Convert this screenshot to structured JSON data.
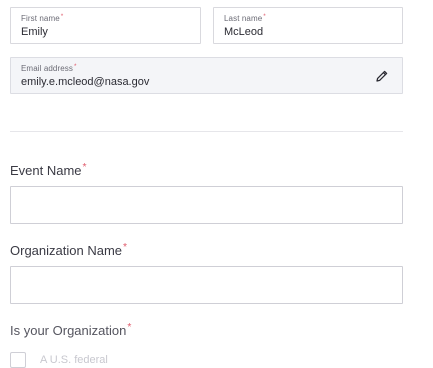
{
  "profile": {
    "first_name": {
      "label": "First name",
      "value": "Emily"
    },
    "last_name": {
      "label": "Last name",
      "value": "McLeod"
    },
    "email": {
      "label": "Email address",
      "value": "emily.e.mcleod@nasa.gov"
    }
  },
  "required_mark": "*",
  "form": {
    "event_name": {
      "label": "Event Name",
      "value": ""
    },
    "organization_name": {
      "label": "Organization Name",
      "value": ""
    },
    "organization_type": {
      "label": "Is your Organization",
      "first_option_partial": "A U.S. federal"
    }
  },
  "icons": {
    "edit": "pencil-icon"
  },
  "colors": {
    "required": "#e05a6b",
    "email_bg": "#f4f5f8",
    "border": "#d9d9de"
  }
}
